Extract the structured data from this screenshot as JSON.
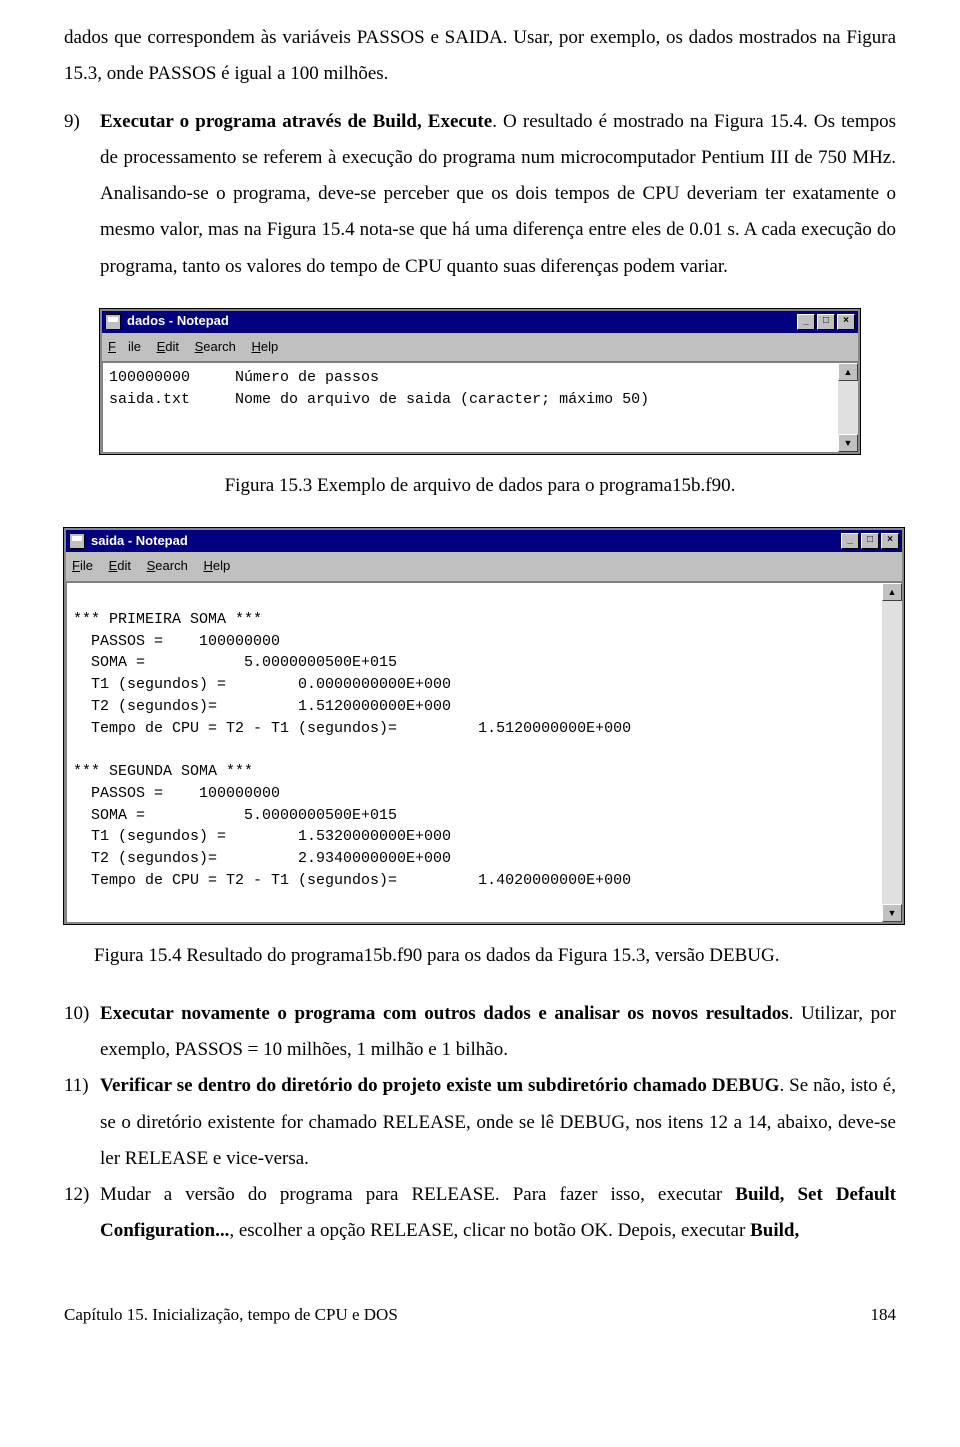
{
  "paragraphs": {
    "p_top": "dados que correspondem às variáveis PASSOS e SAIDA. Usar, por exemplo, os dados mostrados na Figura 15.3, onde PASSOS é igual a 100 milhões.",
    "p9_num": "9)",
    "p9_lead": "Executar o programa através de Build, Execute",
    "p9_tail": ". O resultado é mostrado na Figura 15.4. Os tempos de processamento se referem à execução do programa num microcomputador Pentium III de 750 MHz. Analisando-se o programa, deve-se perceber que os dois tempos de CPU deveriam ter exatamente o mesmo valor, mas na Figura 15.4 nota-se que há uma diferença entre eles de 0.01 s. A cada execução do programa, tanto os valores do tempo de CPU quanto suas diferenças podem variar.",
    "p10_num": "10)",
    "p10_lead": "Executar novamente o programa com outros dados e analisar os novos resultados",
    "p10_tail": ". Utilizar, por exemplo, PASSOS = 10 milhões, 1 milhão e 1 bilhão.",
    "p11_num": "11)",
    "p11_lead": "Verificar se dentro do diretório do projeto existe um subdiretório chamado DEBUG",
    "p11_tail": ". Se não, isto é, se o diretório existente for chamado RELEASE, onde se lê DEBUG, nos itens 12 a 14, abaixo, deve-se ler RELEASE e vice-versa.",
    "p12_num": "12)",
    "p12_a": "Mudar a versão do programa para RELEASE. Para fazer isso, executar ",
    "p12_b": "Build, Set Default Configuration...",
    "p12_c": ", escolher a opção RELEASE, clicar no botão OK",
    "p12_d": ". Depois, executar ",
    "p12_e": "Build,"
  },
  "captions": {
    "c153": "Figura 15.3 Exemplo de arquivo de dados para o programa15b.f90.",
    "c154": "Figura 15.4 Resultado do programa15b.f90 para os dados da Figura 15.3, versão DEBUG."
  },
  "np1": {
    "title": "dados - Notepad",
    "content": "100000000     Número de passos\nsaida.txt     Nome do arquivo de saida (caracter; máximo 50)"
  },
  "np2": {
    "title": "saida - Notepad",
    "content": "\n*** PRIMEIRA SOMA ***\n  PASSOS =    100000000\n  SOMA =           5.0000000500E+015\n  T1 (segundos) =        0.0000000000E+000\n  T2 (segundos)=         1.5120000000E+000\n  Tempo de CPU = T2 - T1 (segundos)=         1.5120000000E+000\n\n*** SEGUNDA SOMA ***\n  PASSOS =    100000000\n  SOMA =           5.0000000500E+015\n  T1 (segundos) =        1.5320000000E+000\n  T2 (segundos)=         2.9340000000E+000\n  Tempo de CPU = T2 - T1 (segundos)=         1.4020000000E+000\n"
  },
  "menu": {
    "file": "File",
    "edit": "Edit",
    "search": "Search",
    "help": "Help"
  },
  "winbtn": {
    "min": "_",
    "max": "□",
    "close": "×"
  },
  "sb": {
    "up": "▲",
    "down": "▼"
  },
  "footer": {
    "left": "Capítulo 15. Inicialização, tempo de CPU e DOS",
    "right": "184"
  }
}
